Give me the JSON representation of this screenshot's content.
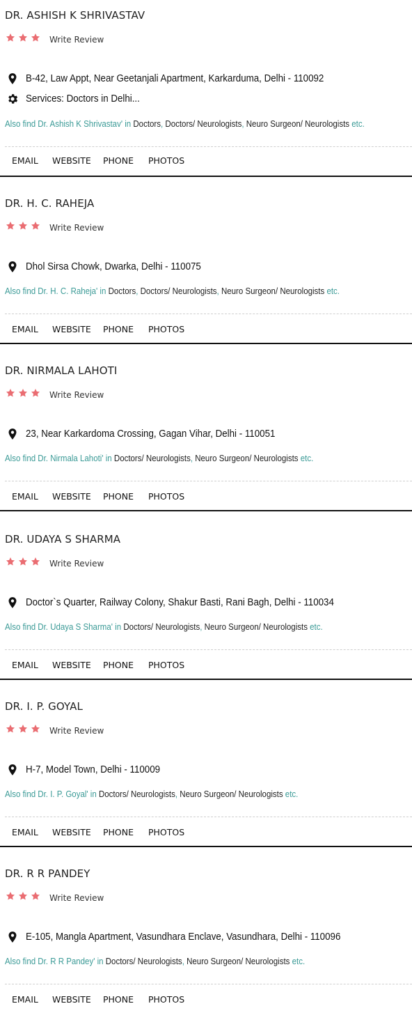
{
  "colors": {
    "star": "#ea6d72",
    "teal": "#3a9a96",
    "text": "#111111"
  },
  "listings": [
    {
      "name": "DR. ASHISH K SHRIVASTAV",
      "rating_stars": 3,
      "write_review": "Write Review",
      "address": "B-42, Law Appt, Near Geetanjali Apartment, Karkarduma, Delhi - 110092",
      "services": "Services: Doctors in Delhi...",
      "also_prefix": "Also find Dr. Ashish K Shrivastav' in",
      "categories": [
        "Doctors",
        "Doctors/ Neurologists",
        "Neuro Surgeon/ Neurologists"
      ],
      "etc": "etc.",
      "actions": [
        "EMAIL",
        "WEBSITE",
        "PHONE",
        "PHOTOS"
      ]
    },
    {
      "name": "DR. H. C. RAHEJA",
      "rating_stars": 3,
      "write_review": "Write Review",
      "address": "Dhol Sirsa Chowk, Dwarka, Delhi - 110075",
      "also_prefix": "Also find Dr. H. C. Raheja' in",
      "categories": [
        "Doctors",
        "Doctors/ Neurologists",
        "Neuro Surgeon/ Neurologists"
      ],
      "etc": "etc.",
      "actions": [
        "EMAIL",
        "WEBSITE",
        "PHONE",
        "PHOTOS"
      ]
    },
    {
      "name": "DR. NIRMALA LAHOTI",
      "rating_stars": 3,
      "write_review": "Write Review",
      "address": "23, Near Karkardoma Crossing, Gagan Vihar, Delhi - 110051",
      "also_prefix": "Also find Dr. Nirmala Lahoti' in",
      "categories": [
        "Doctors/ Neurologists",
        "Neuro Surgeon/ Neurologists"
      ],
      "etc": "etc.",
      "actions": [
        "EMAIL",
        "WEBSITE",
        "PHONE",
        "PHOTOS"
      ]
    },
    {
      "name": "DR. UDAYA S SHARMA",
      "rating_stars": 3,
      "write_review": "Write Review",
      "address": "Doctor`s Quarter, Railway Colony, Shakur Basti, Rani Bagh, Delhi - 110034",
      "also_prefix": "Also find Dr. Udaya S Sharma' in",
      "categories": [
        "Doctors/ Neurologists",
        "Neuro Surgeon/ Neurologists"
      ],
      "etc": "etc.",
      "actions": [
        "EMAIL",
        "WEBSITE",
        "PHONE",
        "PHOTOS"
      ]
    },
    {
      "name": "DR. I. P. GOYAL",
      "rating_stars": 3,
      "write_review": "Write Review",
      "address": "H-7, Model Town, Delhi - 110009",
      "also_prefix": "Also find Dr. I. P. Goyal' in",
      "categories": [
        "Doctors/ Neurologists",
        "Neuro Surgeon/ Neurologists"
      ],
      "etc": "etc.",
      "actions": [
        "EMAIL",
        "WEBSITE",
        "PHONE",
        "PHOTOS"
      ]
    },
    {
      "name": "DR. R R PANDEY",
      "rating_stars": 3,
      "write_review": "Write Review",
      "address": "E-105, Mangla Apartment, Vasundhara Enclave, Vasundhara, Delhi - 110096",
      "also_prefix": "Also find Dr. R R Pandey' in",
      "categories": [
        "Doctors/ Neurologists",
        "Neuro Surgeon/ Neurologists"
      ],
      "etc": "etc.",
      "actions": [
        "EMAIL",
        "WEBSITE",
        "PHONE",
        "PHOTOS"
      ]
    }
  ]
}
